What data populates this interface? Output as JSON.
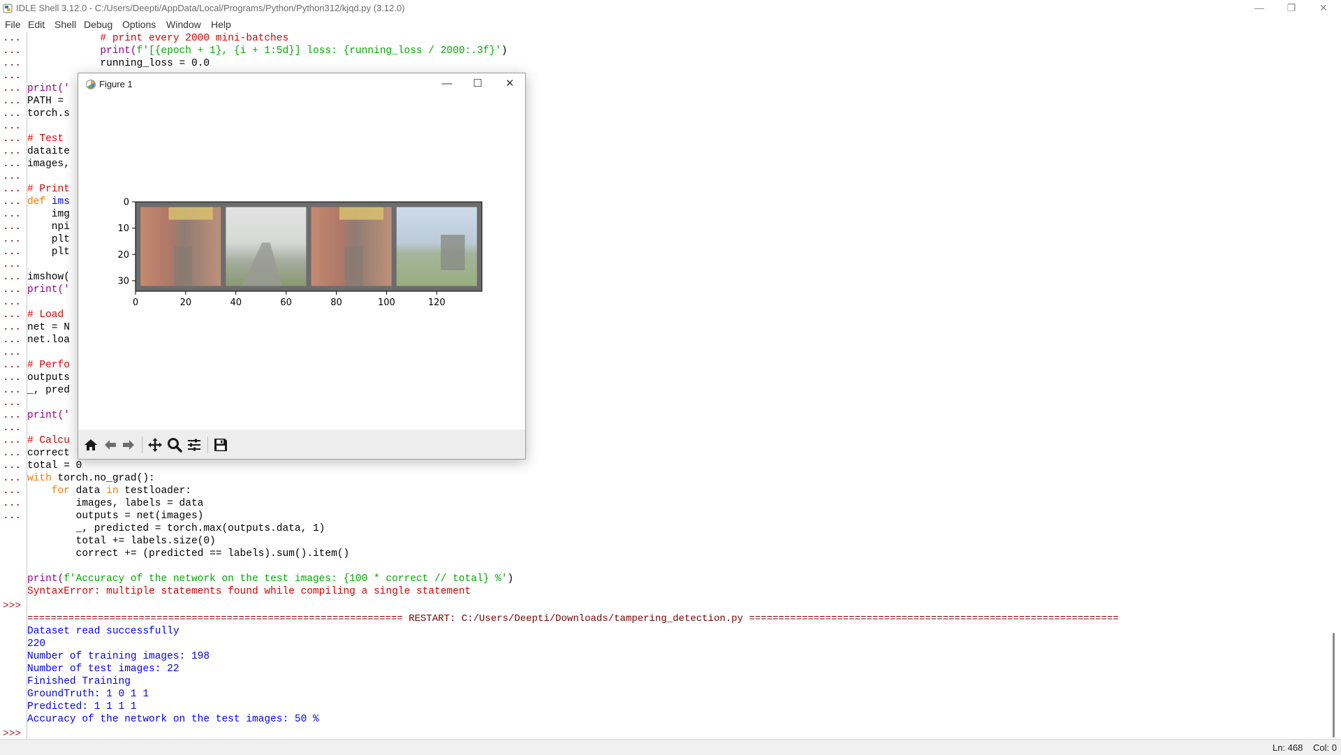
{
  "window": {
    "title": "IDLE Shell 3.12.0 - C:/Users/Deepti/AppData/Local/Programs/Python/Python312/kjqd.py (3.12.0)",
    "minimize": "—",
    "maximize": "❐",
    "close": "✕"
  },
  "menu": {
    "file": "File",
    "edit": "Edit",
    "shell": "Shell",
    "debug": "Debug",
    "options": "Options",
    "window": "Window",
    "help": "Help"
  },
  "colors": {
    "comment": "#dd0000",
    "string": "#00aa00",
    "keyword": "#ff7700",
    "stdout": "#0000ff",
    "stderr": "#dd0000"
  },
  "code": {
    "l1": "            # print every 2000 mini-batches",
    "l2a": "            print(",
    "l2b": "f'[{epoch + 1}, {i + 1:5d}] loss: {running_loss / 2000:.3f}'",
    "l2c": ")",
    "l3": "            running_loss = 0.0",
    "l5": "print('",
    "l6": "PATH = ",
    "l7": "torch.s",
    "l9": "# Test ",
    "l10": "dataite",
    "l11": "images,",
    "l13": "# Print",
    "l14a": "def ",
    "l14b": "ims",
    "l15": "    img",
    "l16": "    npi",
    "l17": "    plt",
    "l18": "    plt",
    "l20": "imshow(",
    "l21": "print('",
    "l23": "# Load ",
    "l24": "net = N",
    "l25": "net.loa",
    "l27": "# Perfo",
    "l28": "outputs",
    "l29": "_, pred",
    "l31": "print('",
    "l33": "# Calcu",
    "l34": "correct",
    "l35": "total = 0",
    "l36a": "with",
    "l36b": " torch.no_grad():",
    "l37a": "    for",
    "l37b": " data ",
    "l37c": "in",
    "l37d": " testloader:",
    "l38": "        images, labels = data",
    "l39": "        outputs = net(images)",
    "l40": "        _, predicted = torch.max(outputs.data, 1)",
    "l41": "        total += labels.size(0)",
    "l42": "        correct += (predicted == labels).sum().item()",
    "l44a": "print(",
    "l44b": "f'Accuracy of the network on the test images: {100 * correct // total} %'",
    "l44c": ")",
    "l45": "SyntaxError: multiple statements found while compiling a single statement",
    "restart": "================================================================ RESTART: C:/Users/Deepti/Downloads/tampering_detection.py ===============================================================",
    "o1": "Dataset read successfully",
    "o2": "220",
    "o3": "Number of training images: 198",
    "o4": "Number of test images: 22",
    "o5": "Finished Training",
    "o6": "GroundTruth: 1 0 1 1",
    "o7": "Predicted: 1 1 1 1",
    "o8": "Accuracy of the network on the test images: 50 %"
  },
  "prompts": {
    "continuation": "...",
    "main": ">>>"
  },
  "status": {
    "line": "Ln: 468",
    "col": "Col: 0"
  },
  "figure": {
    "title": "Figure 1",
    "minimize": "—",
    "maximize": "☐",
    "close": "✕",
    "toolbar": [
      "home-icon",
      "back-arrow-icon",
      "forward-arrow-icon",
      "pan-icon",
      "zoom-icon",
      "configure-subplots-icon",
      "save-icon"
    ]
  },
  "chart_data": {
    "type": "image",
    "title": "",
    "xlabel": "",
    "ylabel": "",
    "xlim": [
      0,
      138
    ],
    "ylim": [
      34,
      0
    ],
    "xticks": [
      0,
      20,
      40,
      60,
      80,
      100,
      120
    ],
    "yticks": [
      0,
      10,
      20,
      30
    ],
    "tiles": [
      {
        "x_start": 2,
        "x_end": 34,
        "description_colors": [
          "#b8846a",
          "#d8c070",
          "#8a7a70"
        ]
      },
      {
        "x_start": 36,
        "x_end": 68,
        "description_colors": [
          "#dadada",
          "#9aa096",
          "#8aa06a"
        ]
      },
      {
        "x_start": 70,
        "x_end": 102,
        "description_colors": [
          "#b8846a",
          "#d8c070",
          "#8a7a70"
        ]
      },
      {
        "x_start": 104,
        "x_end": 136,
        "description_colors": [
          "#c8d8e8",
          "#a0b090",
          "#90a070"
        ]
      }
    ]
  }
}
